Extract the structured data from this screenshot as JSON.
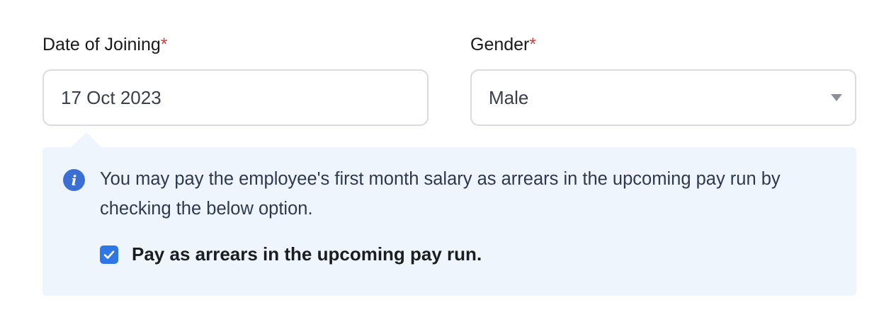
{
  "form": {
    "date_of_joining": {
      "label": "Date of Joining",
      "required_mark": "*",
      "value": "17 Oct 2023"
    },
    "gender": {
      "label": "Gender",
      "required_mark": "*",
      "value": "Male",
      "caret_icon": "chevron-down-icon"
    }
  },
  "info_box": {
    "icon": "info-icon",
    "icon_glyph": "i",
    "message": "You may pay the employee's first month salary as arrears in the upcoming pay run by checking the below option.",
    "checkbox": {
      "checked": true,
      "label": "Pay as arrears in the upcoming pay run."
    }
  },
  "colors": {
    "required": "#e03b3b",
    "info_background": "#eef5fd",
    "info_icon": "#3b6fd6",
    "checkbox": "#2f76e6"
  }
}
